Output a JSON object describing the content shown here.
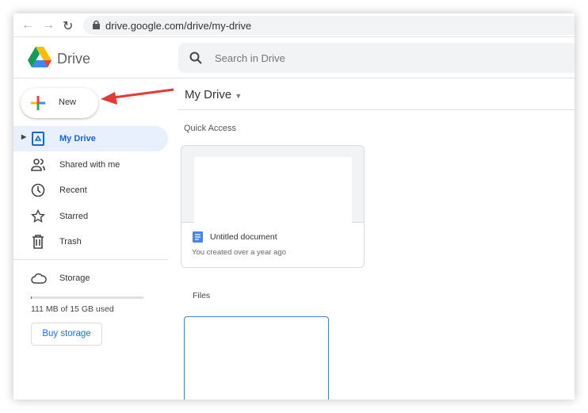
{
  "browser": {
    "url": "drive.google.com/drive/my-drive"
  },
  "header": {
    "app_name": "Drive",
    "search_placeholder": "Search in Drive"
  },
  "sidebar": {
    "new_label": "New",
    "items": [
      {
        "label": "My Drive",
        "icon": "my-drive-icon",
        "selected": true
      },
      {
        "label": "Shared with me",
        "icon": "people-icon"
      },
      {
        "label": "Recent",
        "icon": "clock-icon"
      },
      {
        "label": "Starred",
        "icon": "star-icon"
      },
      {
        "label": "Trash",
        "icon": "trash-icon"
      }
    ],
    "storage": {
      "label": "Storage",
      "used_text": "111 MB of 15 GB used",
      "used_fraction": 0.007,
      "buy_label": "Buy storage"
    }
  },
  "main": {
    "title": "My Drive",
    "quick_access_label": "Quick Access",
    "quick_access": [
      {
        "name": "Untitled document",
        "subtitle": "You created over a year ago"
      }
    ],
    "files_label": "Files"
  },
  "colors": {
    "accent": "#1a73e8",
    "selected_bg": "#e8f0fe",
    "arrow": "#e53935"
  }
}
